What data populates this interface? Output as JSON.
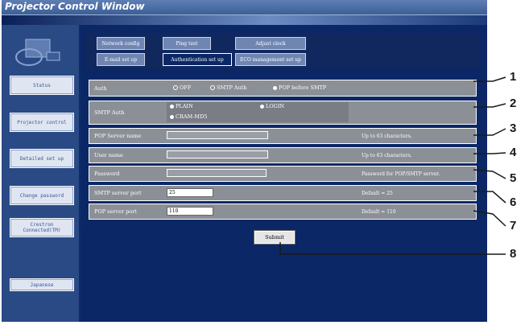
{
  "window": {
    "title": "Projector Control Window"
  },
  "sidebar": {
    "items": [
      {
        "label": "Status"
      },
      {
        "label": "Projector control"
      },
      {
        "label": "Detailed set up"
      },
      {
        "label": "Change password"
      },
      {
        "label": "Crestron Connected(TM)"
      },
      {
        "label": "Japanese"
      }
    ]
  },
  "tabs": [
    {
      "label": "Network config"
    },
    {
      "label": "Ping test"
    },
    {
      "label": "Adjust clock"
    },
    {
      "label": "E-mail set up"
    },
    {
      "label": "Authentication set up"
    },
    {
      "label": "ECO management set up"
    }
  ],
  "form": {
    "auth": {
      "label": "Auth",
      "options": [
        "OFF",
        "SMTP Auth",
        "POP before SMTP"
      ],
      "selected": "POP before SMTP"
    },
    "smtp_auth": {
      "label": "SMTP Auth",
      "options": [
        "PLAIN",
        "LOGIN",
        "CRAM-MD5"
      ]
    },
    "pop_server": {
      "label": "POP Server name",
      "value": "",
      "help": "Up to 63 characters."
    },
    "user_name": {
      "label": "User name",
      "value": "",
      "help": "Up to 63 characters."
    },
    "password": {
      "label": "Password",
      "value": "",
      "help": "Password for POP/SMTP server."
    },
    "smtp_port": {
      "label": "SMTP server port",
      "value": "25",
      "help": "Default = 25"
    },
    "pop_port": {
      "label": "POP server port",
      "value": "110",
      "help": "Default = 110"
    },
    "submit_label": "Submit"
  },
  "callouts": [
    "1",
    "2",
    "3",
    "4",
    "5",
    "6",
    "7",
    "8"
  ],
  "colors": {
    "window": "#0f2c6a",
    "sidebar": "#2a4a86",
    "row": "#8b8f96"
  }
}
